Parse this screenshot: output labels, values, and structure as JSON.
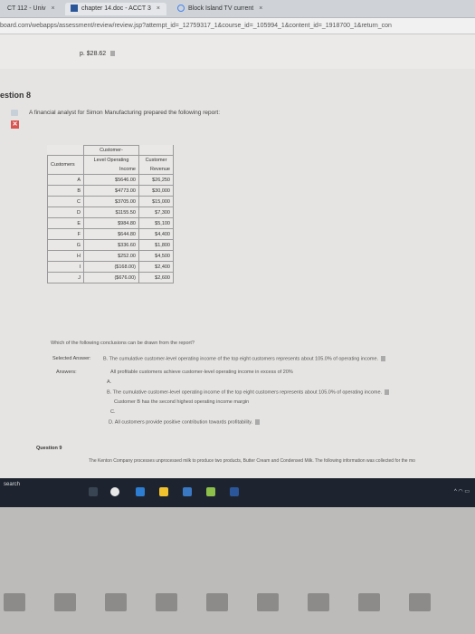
{
  "browser": {
    "tabs": [
      {
        "label": "CT 112 - Univ",
        "active": false
      },
      {
        "label": "chapter 14.doc - ACCT 3",
        "active": true
      },
      {
        "label": "Block Island TV current",
        "active": false
      }
    ],
    "url": "board.com/webapps/assessment/review/review.jsp?attempt_id=_12759317_1&course_id=_105994_1&content_id=_1918700_1&return_con",
    "url_host": "board.com"
  },
  "header": {
    "price_line": "p. $28.62"
  },
  "question": {
    "title": "estion 8",
    "prompt": "A financial analyst for Simon Manufacturing prepared the following report:",
    "status": "incorrect"
  },
  "report": {
    "headers": {
      "customer": "Customers",
      "operating": "Customer-Level Operating Income",
      "operating_lines": [
        "Customer-",
        "Level Operating",
        "Income"
      ],
      "revenue_lines": [
        "Customer",
        "Revenue"
      ]
    },
    "rows": [
      {
        "customer": "A",
        "operating": "$5646.00",
        "revenue": "$26,250"
      },
      {
        "customer": "B",
        "operating": "$4773.00",
        "revenue": "$30,000"
      },
      {
        "customer": "C",
        "operating": "$3705.00",
        "revenue": "$15,000"
      },
      {
        "customer": "D",
        "operating": "$1155.50",
        "revenue": "$7,300"
      },
      {
        "customer": "E",
        "operating": "$984.80",
        "revenue": "$5,100"
      },
      {
        "customer": "F",
        "operating": "$644.80",
        "revenue": "$4,400"
      },
      {
        "customer": "G",
        "operating": "$336.60",
        "revenue": "$1,800"
      },
      {
        "customer": "H",
        "operating": "$252.00",
        "revenue": "$4,500"
      },
      {
        "customer": "I",
        "operating": "($168.00)",
        "revenue": "$2,400"
      },
      {
        "customer": "J",
        "operating": "($676.00)",
        "revenue": "$2,600"
      }
    ]
  },
  "conclusion_question": "Which of the following conclusions can be drawn from the report?",
  "answers": {
    "selected_label": "Selected Answer:",
    "selected_text": "B. The cumulative customer-level operating income of the top eight customers represents about 105.0% of operating income.",
    "answers_label": "Answers:",
    "option_a": "All profitable customers achieve customer-level operating income in excess of 20%",
    "option_a_letter": "A.",
    "option_b": "B. The cumulative customer-level operating income of the top eight customers represents about 105.0% of operating income.",
    "option_c": "Customer B has the second highest operating income margin",
    "option_c_letter": "C.",
    "option_d": "D. All customers provide positive contribution towards profitability."
  },
  "next_question": {
    "title": "Question 9",
    "text": "The Kenton Company processes unprocessed milk to produce two products, Butter Cream and Condensed Milk. The following information was collected for the mo"
  },
  "taskbar": {
    "search_text": "search"
  },
  "colors": {
    "incorrect": "#d9534f",
    "taskbar": "#1d2430"
  }
}
